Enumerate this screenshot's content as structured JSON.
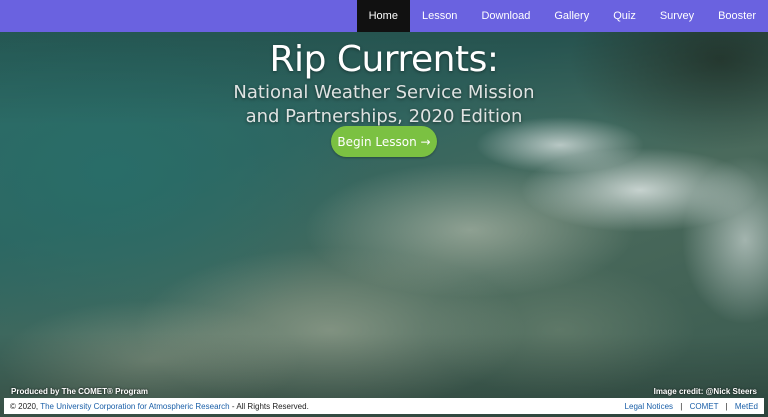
{
  "nav": {
    "items": [
      {
        "label": "Home",
        "active": true
      },
      {
        "label": "Lesson"
      },
      {
        "label": "Download"
      },
      {
        "label": "Gallery"
      },
      {
        "label": "Quiz"
      },
      {
        "label": "Survey"
      },
      {
        "label": "Booster"
      }
    ],
    "color": "#6a62e0",
    "active_color": "#111111"
  },
  "hero": {
    "title": "Rip Currents:",
    "subtitle_line1": "National Weather Service Mission",
    "subtitle_line2": "and Partnerships, 2020 Edition",
    "begin_label": "Begin Lesson →",
    "begin_color": "#7bc142"
  },
  "captions": {
    "produced_by": "Produced by The COMET® Program",
    "image_credit": "Image credit: @Nick Steers"
  },
  "footer": {
    "copyright_prefix": "© 2020,",
    "ucar_link": "The University Corporation for Atmospheric Research",
    "copyright_suffix": "- All Rights Reserved.",
    "legal_link": "Legal Notices",
    "comet_link": "COMET",
    "meted_link": "MetEd",
    "separator": "|"
  }
}
